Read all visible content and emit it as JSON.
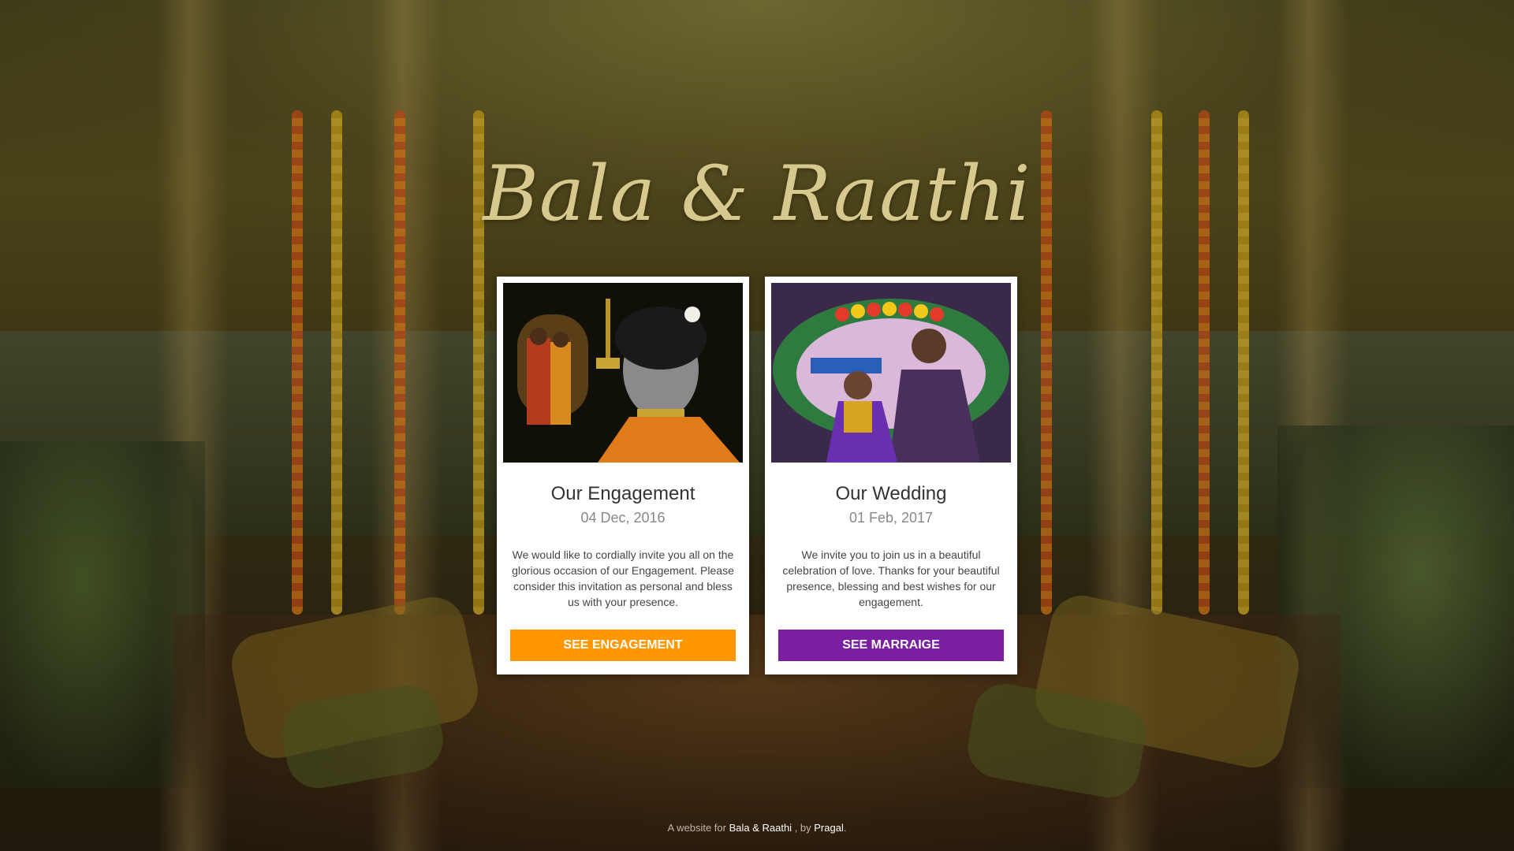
{
  "site": {
    "title": "Bala & Raathi"
  },
  "cards": [
    {
      "title": "Our Engagement",
      "date": "04 Dec, 2016",
      "text": "We would like to cordially invite you all on the glorious occasion of our Engagement. Please consider this invitation as personal and bless us with your presence.",
      "button_label": "SEE ENGAGEMENT",
      "button_color": "#ff9800"
    },
    {
      "title": "Our Wedding",
      "date": "01 Feb, 2017",
      "text": "We invite you to join us in a beautiful celebration of love. Thanks for your beautiful presence, blessing and best wishes for our engagement.",
      "button_label": "SEE MARRAIGE",
      "button_color": "#7b1fa2"
    }
  ],
  "footer": {
    "prefix": "A website for ",
    "couple": "Bala & Raathi",
    "by": " , by ",
    "author": "Pragal",
    "suffix": "."
  },
  "colors": {
    "title": "#d7c98e",
    "card_bg": "#ffffff"
  }
}
